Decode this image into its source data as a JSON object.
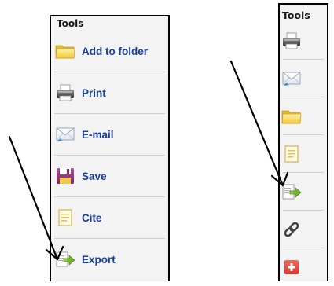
{
  "expanded_panel": {
    "title": "Tools",
    "items": [
      {
        "label": "Add to folder",
        "icon": "folder-icon"
      },
      {
        "label": "Print",
        "icon": "printer-icon"
      },
      {
        "label": "E-mail",
        "icon": "email-icon"
      },
      {
        "label": "Save",
        "icon": "floppy-disk-icon"
      },
      {
        "label": "Cite",
        "icon": "document-icon"
      },
      {
        "label": "Export",
        "icon": "export-document-icon"
      }
    ]
  },
  "collapsed_panel": {
    "title": "Tools",
    "items": [
      {
        "icon": "printer-icon"
      },
      {
        "icon": "email-icon"
      },
      {
        "icon": "folder-icon"
      },
      {
        "icon": "document-icon"
      },
      {
        "icon": "export-document-icon"
      },
      {
        "icon": "link-icon"
      },
      {
        "icon": "plus-icon"
      }
    ]
  },
  "colors": {
    "label": "#1a3f9a",
    "panel_background": "#f3f3f3",
    "border": "#000000",
    "plus_red": "#e84a3c"
  }
}
